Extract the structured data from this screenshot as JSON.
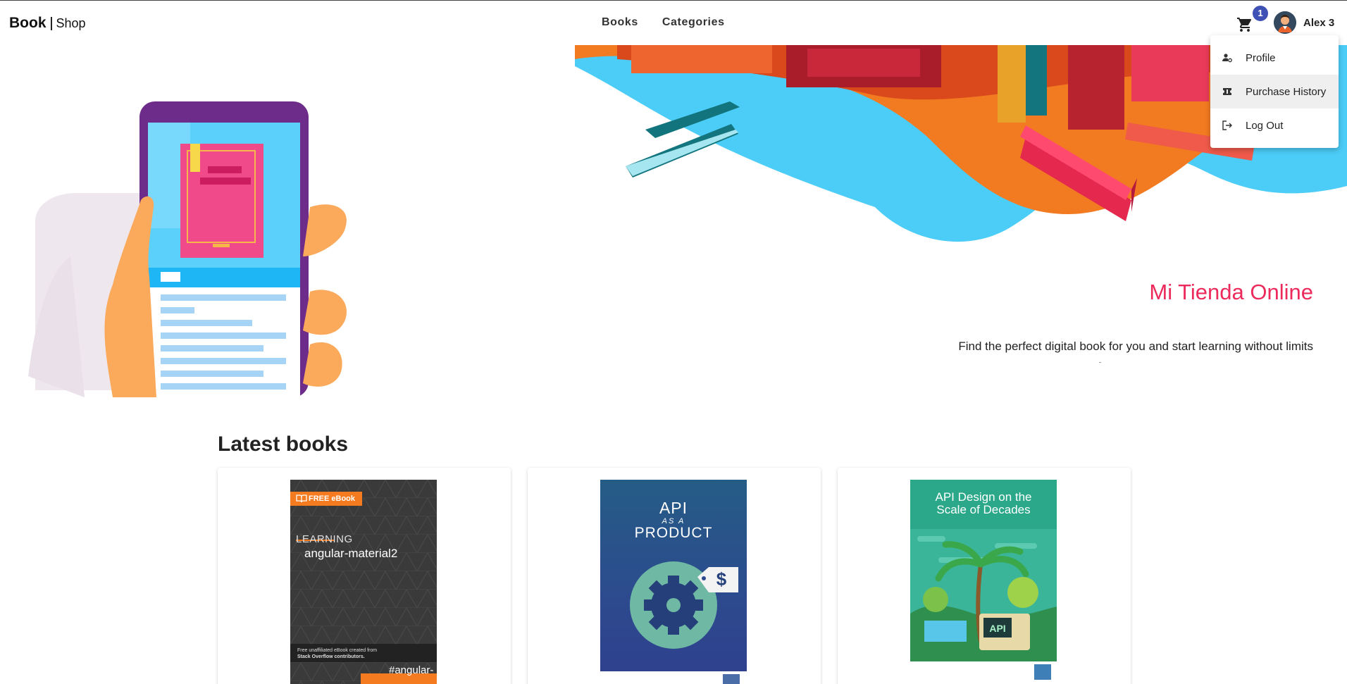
{
  "header": {
    "brand_primary": "Book",
    "brand_secondary": "Shop",
    "nav": [
      "Books",
      "Categories"
    ],
    "cart_count": "1",
    "user_name": "Alex 3"
  },
  "user_menu": {
    "items": [
      {
        "label": "Profile",
        "icon": "person-settings-icon"
      },
      {
        "label": "Purchase History",
        "icon": "ticket-icon"
      },
      {
        "label": "Log Out",
        "icon": "logout-icon"
      }
    ]
  },
  "hero": {
    "title": "Mi Tienda Online",
    "subtitle": "Find the perfect digital book for you and start learning without limits"
  },
  "latest": {
    "title": "Latest books",
    "books": [
      {
        "cover_badge": "FREE eBook",
        "cover_line1": "LEARNING",
        "cover_line2": "angular-material2",
        "cover_note1": "Free unaffiliated eBook created from",
        "cover_note2": "Stack Overflow contributors.",
        "cover_tag": "#angular-"
      },
      {
        "cover_line1": "API",
        "cover_line2": "AS A",
        "cover_line3": "PRODUCT"
      },
      {
        "cover_line1": "API Design on the",
        "cover_line2": "Scale of Decades",
        "cover_label": "API"
      }
    ]
  },
  "colors": {
    "accent": "#ec2a5b",
    "badge": "#3f51b5",
    "ebook_orange": "#f47b20"
  }
}
